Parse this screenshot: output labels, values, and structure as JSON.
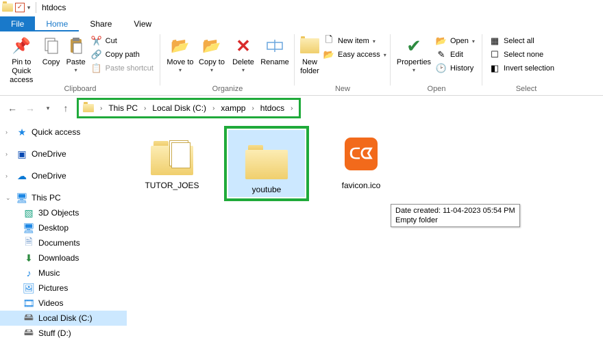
{
  "title": "htdocs",
  "qat": {
    "check_state": "✓"
  },
  "tabs": {
    "file": "File",
    "home": "Home",
    "share": "Share",
    "view": "View"
  },
  "ribbon": {
    "clipboard": {
      "label": "Clipboard",
      "pin": "Pin to Quick access",
      "copy": "Copy",
      "paste": "Paste",
      "cut": "Cut",
      "copy_path": "Copy path",
      "paste_shortcut": "Paste shortcut"
    },
    "organize": {
      "label": "Organize",
      "move_to": "Move to",
      "copy_to": "Copy to",
      "delete": "Delete",
      "rename": "Rename"
    },
    "new": {
      "label": "New",
      "new_folder": "New folder",
      "new_item": "New item",
      "easy_access": "Easy access"
    },
    "open": {
      "label": "Open",
      "properties": "Properties",
      "open": "Open",
      "edit": "Edit",
      "history": "History"
    },
    "select": {
      "label": "Select",
      "select_all": "Select all",
      "select_none": "Select none",
      "invert": "Invert selection"
    }
  },
  "breadcrumb": [
    "This PC",
    "Local Disk (C:)",
    "xampp",
    "htdocs"
  ],
  "sidebar": {
    "quick_access": "Quick access",
    "onedrive1": "OneDrive",
    "onedrive2": "OneDrive",
    "this_pc": "This PC",
    "objects3d": "3D Objects",
    "desktop": "Desktop",
    "documents": "Documents",
    "downloads": "Downloads",
    "music": "Music",
    "pictures": "Pictures",
    "videos": "Videos",
    "local_c": "Local Disk (C:)",
    "stuff_d": "Stuff (D:)"
  },
  "items": [
    {
      "name": "TUTOR_JOES",
      "type": "folder"
    },
    {
      "name": "youtube",
      "type": "folder"
    },
    {
      "name": "favicon.ico",
      "type": "file"
    }
  ],
  "tooltip": {
    "line1": "Date created: 11-04-2023 05:54 PM",
    "line2": "Empty folder"
  }
}
